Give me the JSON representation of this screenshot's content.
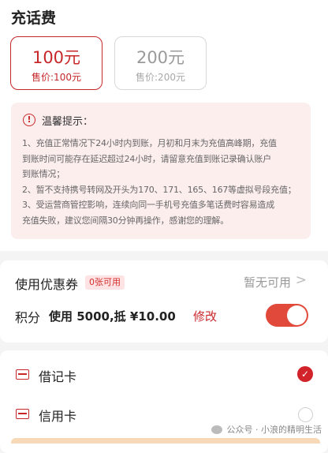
{
  "recharge": {
    "title": "充话费",
    "options": [
      {
        "amount": "100元",
        "price": "售价:100元",
        "selected": true
      },
      {
        "amount": "200元",
        "price": "售价:200元",
        "selected": false
      }
    ]
  },
  "notice": {
    "icon": "alert-circle-icon",
    "title": "温馨提示：",
    "lines": [
      "1、充值正常情况下24小时内到账，月初和月末为充值高峰期，充值",
      "到账时间可能存在延迟超过24小时，请留意充值到账记录确认账户",
      "到账情况；",
      "2、暂不支持携号转网及开头为170、171、165、167等虚拟号段充值；",
      "3、受运营商管控影响，连续向同一手机号充值多笔话费时容易造成",
      "充值失败，建议您间隔30分钟再操作，感谢您的理解。"
    ]
  },
  "coupon": {
    "label": "使用优惠券",
    "badge": "0张可用",
    "status": "暂无可用",
    "chevron": ">"
  },
  "points": {
    "label": "积分",
    "value": "使用 5000,抵 ¥10.00",
    "edit_label": "修改",
    "enabled": true
  },
  "payment": {
    "methods": [
      {
        "label": "借记卡",
        "icon": "card-icon",
        "selected": true
      },
      {
        "label": "信用卡",
        "icon": "card-icon",
        "selected": false
      }
    ]
  },
  "watermark": "公众号 · 小浪的精明生活",
  "colors": {
    "accent": "#c8272a",
    "notice_bg": "#fdeeee",
    "toggle_on": "#e14a3b"
  }
}
